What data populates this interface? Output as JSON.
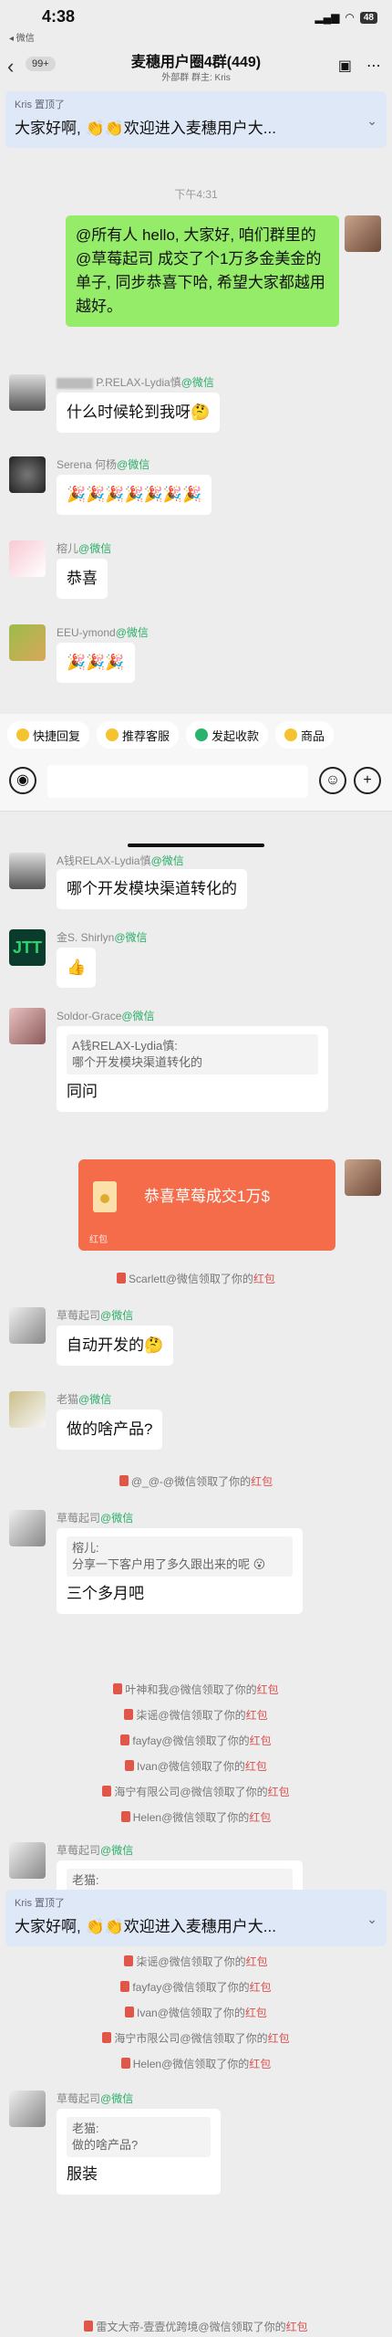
{
  "status": {
    "time": "4:38",
    "back_app": "◂ 微信",
    "battery": "48"
  },
  "header": {
    "back_count": "99+",
    "title": "麦穗用户圈4群(449)",
    "subtitle": "外部群   群主: Kris"
  },
  "pinned": [
    {
      "who": "Kris 置顶了",
      "msg": "大家好啊, 👏👏欢迎进入麦穗用户大..."
    },
    {
      "who": "Kris 置顶了",
      "msg": "大家好啊, 👏👏欢迎进入麦穗用户大..."
    }
  ],
  "time_label": "下午4:31",
  "messages": {
    "me_1": "@所有人 hello, 大家好, 咱们群里的 @草莓起司 成交了个1万多金美金的单子, 同步恭喜下哈, 希望大家都越用越好。",
    "lydia_name": "P.RELAX-Lydia慎",
    "lydia_msg": "什么时候轮到我呀🤔",
    "serena_name": "Serena 何杨",
    "serena_msg": "🎉🎉🎉🎉🎉🎉🎉",
    "liner_name": "榕儿",
    "liner_msg": "恭喜",
    "eeu_name": "EEU-ymond",
    "eeu_msg": "🎉🎉🎉",
    "a_name": "A钱RELAX-Lydia慎",
    "a_msg": "哪个开发模块渠道转化的",
    "shirlyn_name": "金S. Shirlyn",
    "shirlyn_msg": "👍",
    "soldor_name": "Soldor-Grace",
    "soldor_quote": "A钱RELAX-Lydia慎:\n哪个开发模块渠道转化的",
    "soldor_msg": "同问",
    "redpacket": "恭喜草莓成交1万$",
    "redpacket_foot": "红包",
    "caomei_name": "草莓起司",
    "caomei_msg1": "自动开发的🤔",
    "laomao_name": "老猫",
    "laomao_msg": "做的啥产品?",
    "caomei_quote1": "榕儿:\n分享一下客户用了多久跟出来的呢 😮",
    "caomei_msg2": "三个多月吧",
    "caomei_quote2": "老猫:",
    "caomei_quote3": "老猫:\n做的啥产品?",
    "caomei_msg3": "服装"
  },
  "wx_tag": "@微信",
  "system": [
    "Scarlett@微信领取了你的",
    "@_@-@微信领取了你的",
    "叶神和我@微信领取了你的",
    "柒谣@微信领取了你的",
    "fayfay@微信领取了你的",
    "Ivan@微信领取了你的",
    "海宁有限公司@微信领取了你的",
    "Helen@微信领取了你的",
    "柒谣@微信领取了你的",
    "fayfay@微信领取了你的",
    "Ivan@微信领取了你的",
    "海宁市限公司@微信领取了你的",
    "Helen@微信领取了你的",
    "雷文大帝-壹壹优跨境@微信领取了你的"
  ],
  "red_word": "红包",
  "toolbar": [
    "快捷回复",
    "推荐客服",
    "发起收款",
    "商品"
  ],
  "colors": {
    "bubble_me": "#95ec69",
    "wechat_green": "#2aae67",
    "red_packet": "#f56c4b",
    "pinned_bg": "#dfe8f7"
  }
}
